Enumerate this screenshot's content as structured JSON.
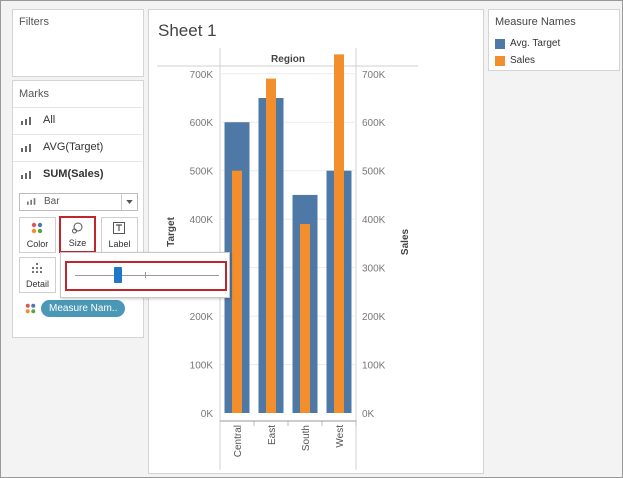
{
  "filters": {
    "title": "Filters"
  },
  "marks": {
    "title": "Marks",
    "rows": [
      "All",
      "AVG(Target)",
      "SUM(Sales)"
    ],
    "mark_type": "Bar",
    "cards": {
      "color": "Color",
      "size": "Size",
      "label": "Label",
      "detail": "Detail"
    },
    "pill": "Measure Nam..",
    "size_slider": {
      "value": 0.3
    }
  },
  "sheet": {
    "title": "Sheet 1"
  },
  "legend": {
    "title": "Measure Names",
    "items": [
      {
        "label": "Avg. Target",
        "color": "#4e79a7"
      },
      {
        "label": "Sales",
        "color": "#f28e2b"
      }
    ]
  },
  "chart_data": {
    "type": "bar",
    "header": "Region",
    "categories": [
      "Central",
      "East",
      "South",
      "West"
    ],
    "series": [
      {
        "name": "Avg. Target",
        "values": [
          600000,
          650000,
          450000,
          500000
        ],
        "color": "#4e79a7"
      },
      {
        "name": "Sales",
        "values": [
          500000,
          690000,
          390000,
          740000
        ],
        "color": "#f28e2b"
      }
    ],
    "ylabel_left": "Target",
    "ylabel_right": "Sales",
    "ylim": [
      0,
      780000
    ],
    "left_ticks": [
      [
        "0K",
        0
      ],
      [
        "100K",
        100000
      ],
      [
        "200K",
        200000
      ],
      [
        "300K",
        300000
      ],
      [
        "400K",
        400000
      ],
      [
        "500K",
        500000
      ],
      [
        "600K",
        600000
      ],
      [
        "700K",
        700000
      ]
    ],
    "right_ticks": [
      [
        "0K",
        0
      ],
      [
        "100K",
        100000
      ],
      [
        "200K",
        200000
      ],
      [
        "300K",
        300000
      ],
      [
        "400K",
        400000
      ],
      [
        "500K",
        500000
      ],
      [
        "600K",
        600000
      ],
      [
        "700K",
        700000
      ]
    ]
  }
}
